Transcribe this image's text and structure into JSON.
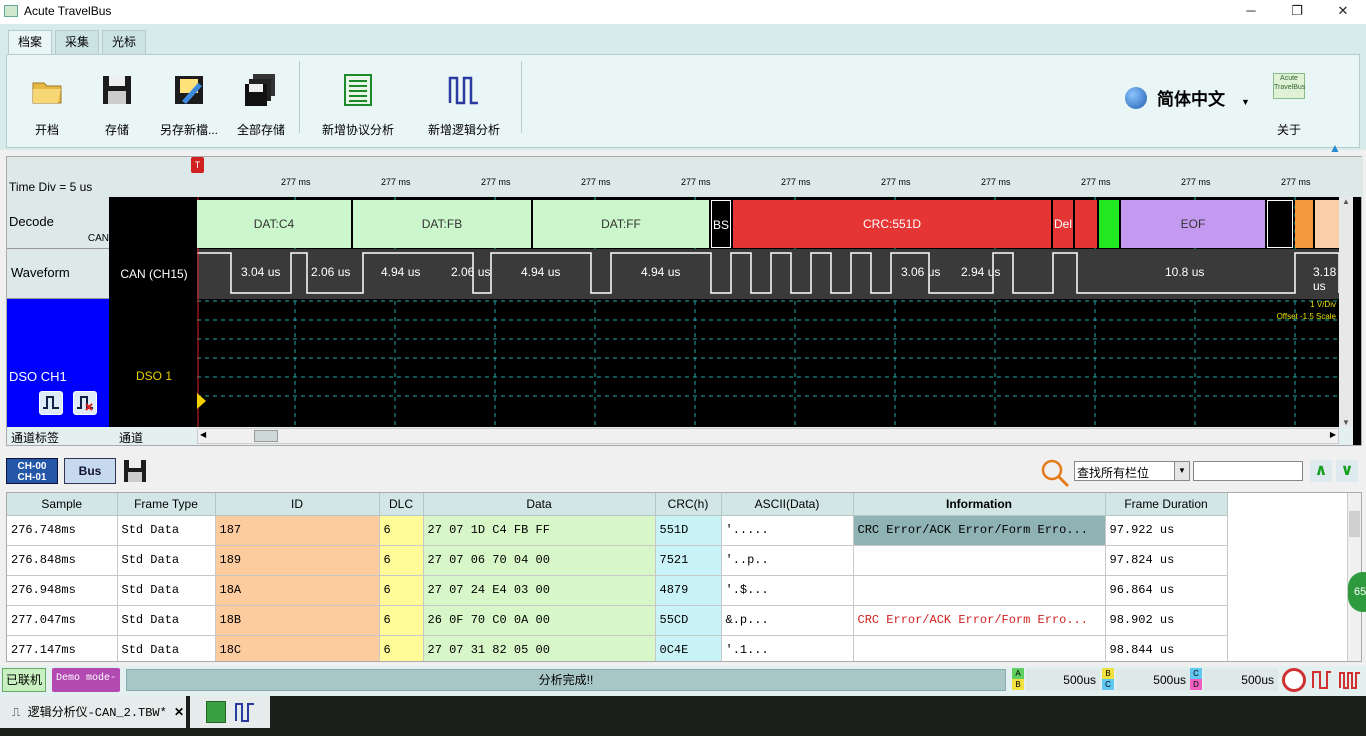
{
  "window": {
    "title": "Acute TravelBus",
    "min": "─",
    "max": "❐",
    "close": "✕"
  },
  "tabs": [
    "档案",
    "采集",
    "光标"
  ],
  "ribbon": {
    "open": "开档",
    "save": "存储",
    "save_as": "另存新檔...",
    "save_all": "全部存储",
    "add_protocol": "新增协议分析",
    "add_logic": "新增逻辑分析",
    "language": "简体中文",
    "about": "关于",
    "logo_text": "Acute TravelBus"
  },
  "wave": {
    "time_div": "Time Div = 5 us",
    "ticks": [
      "277 ms",
      "277 ms",
      "277 ms",
      "277 ms",
      "277 ms",
      "277 ms",
      "277 ms",
      "277 ms",
      "277 ms",
      "277 ms",
      "277 ms"
    ],
    "rows": {
      "decode": "Decode",
      "decode_sub": "CAN",
      "waveform": "Waveform",
      "dso": "DSO CH1"
    },
    "channel": {
      "can": "CAN (CH15)",
      "dso": "DSO 1"
    },
    "segments": [
      {
        "text": "DAT:C4",
        "color": "#ccf7cc"
      },
      {
        "text": "DAT:FB",
        "color": "#ccf7cc"
      },
      {
        "text": "DAT:FF",
        "color": "#ccf7cc"
      },
      {
        "text": "BS",
        "color": "#000000"
      },
      {
        "text": "CRC:551D",
        "color": "#e53535"
      },
      {
        "text": "Del",
        "color": "#e53535"
      },
      {
        "text": "",
        "color": "#e53535"
      },
      {
        "text": "",
        "color": "#22e822"
      },
      {
        "text": "EOF",
        "color": "#c39af0"
      },
      {
        "text": "",
        "color": "#000000"
      },
      {
        "text": "",
        "color": "#f39a3c"
      },
      {
        "text": "",
        "color": "#fbd0a8"
      }
    ],
    "widths": [
      "3.04 us",
      "2.06 us",
      "4.94 us",
      "2.06 us",
      "4.94 us",
      "4.94 us",
      "3.06 us",
      "2.94 us",
      "10.8 us",
      "3.18 us"
    ],
    "dso_scale": "1 V/Div",
    "dso_offset": "Offset -1.5 Scale",
    "footer_label": "通道标签",
    "footer_channel": "通道"
  },
  "toolbar2": {
    "ch_top": "CH-00",
    "ch_bottom": "CH-01",
    "bus": "Bus",
    "search_select": "查找所有栏位",
    "search_value": ""
  },
  "grid": {
    "headers": [
      "Sample",
      "Frame Type",
      "ID",
      "DLC",
      "Data",
      "CRC(h)",
      "ASCII(Data)",
      "Information",
      "Frame Duration"
    ],
    "rows": [
      [
        "276.748ms",
        "Std Data",
        "187",
        "6",
        "27 07 1D C4 FB FF",
        "551D",
        "'.....",
        "CRC Error/ACK Error/Form Erro...",
        "97.922 us"
      ],
      [
        "276.848ms",
        "Std Data",
        "189",
        "6",
        "27 07 06 70 04 00",
        "7521",
        "'..p..",
        "",
        "97.824 us"
      ],
      [
        "276.948ms",
        "Std Data",
        "18A",
        "6",
        "27 07 24 E4 03 00",
        "4879",
        "'.$...",
        "",
        "96.864 us"
      ],
      [
        "277.047ms",
        "Std Data",
        "18B",
        "6",
        "26 0F 70 C0 0A 00",
        "55CD",
        "&.p...",
        "CRC Error/ACK Error/Form Erro...",
        "98.902 us"
      ],
      [
        "277.147ms",
        "Std Data",
        "18C",
        "6",
        "27 07 31 82 05 00",
        "0C4E",
        "'.1...",
        "",
        "98.844 us"
      ]
    ]
  },
  "status": {
    "connected": "已联机",
    "demo": "Demo mode-",
    "progress": "分析完成!!",
    "t1": "500us",
    "t2": "500us",
    "t3": "500us",
    "ab_a": "A",
    "ab_b": "B",
    "bc_b": "B",
    "bc_c": "C",
    "cd_c": "C",
    "cd_d": "D"
  },
  "doc_tab": {
    "title": "逻辑分析仪-CAN_2.TBW*"
  },
  "side_badge": "65"
}
